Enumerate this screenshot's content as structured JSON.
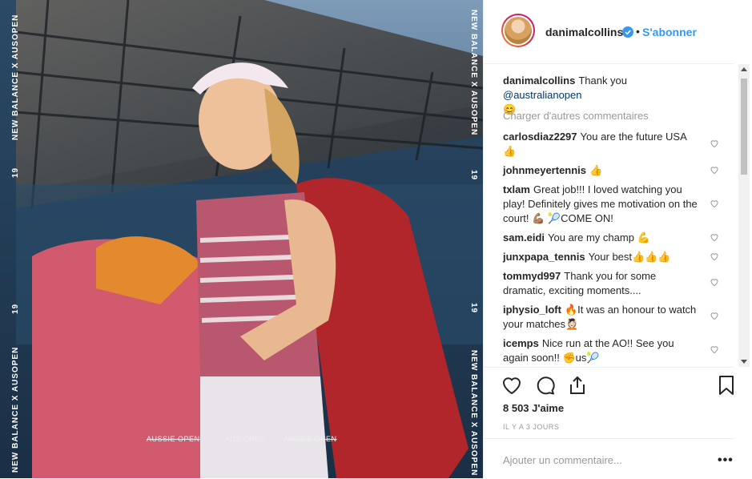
{
  "media": {
    "side_text": "NEW BALANCE X AUSOPEN",
    "side_number": "19",
    "overlay_captions": [
      "AUSSIE OPEN",
      "AUS OPEN",
      "AUSSIE OPEN"
    ]
  },
  "header": {
    "username": "danimalcollins",
    "dot": "•",
    "follow_label": "S'abonner"
  },
  "caption": {
    "username": "danimalcollins",
    "text": "Thank you ",
    "mention": "@australianopen",
    "emoji": "😊"
  },
  "load_more_label": "Charger d'autres commentaires",
  "comments": [
    {
      "user": "carlosdiaz2297",
      "text": "You are the future USA 👍"
    },
    {
      "user": "johnmeyertennis",
      "text": "👍"
    },
    {
      "user": "txlam",
      "text": "Great job!!! I loved watching you play! Definitely gives me motivation on the court! 💪🏽 🎾COME ON!"
    },
    {
      "user": "sam.eidi",
      "text": "You are my champ 💪"
    },
    {
      "user": "junxpapa_tennis",
      "text": "Your best👍👍👍"
    },
    {
      "user": "tommyd997",
      "text": "Thank you for some dramatic, exciting moments...."
    },
    {
      "user": "iphysio_loft",
      "text": "🔥It was an honour to watch your matches💆🏻"
    },
    {
      "user": "icemps",
      "text": "Nice run at the AO!! See you again soon!! ✊us🎾"
    }
  ],
  "likes": "8 503 J'aime",
  "time": "IL Y A 3 JOURS",
  "comment_input": {
    "placeholder": "Ajouter un commentaire..."
  },
  "more_label": "•••",
  "colors": {
    "link": "#3897f0",
    "verified": "#3897f0"
  }
}
